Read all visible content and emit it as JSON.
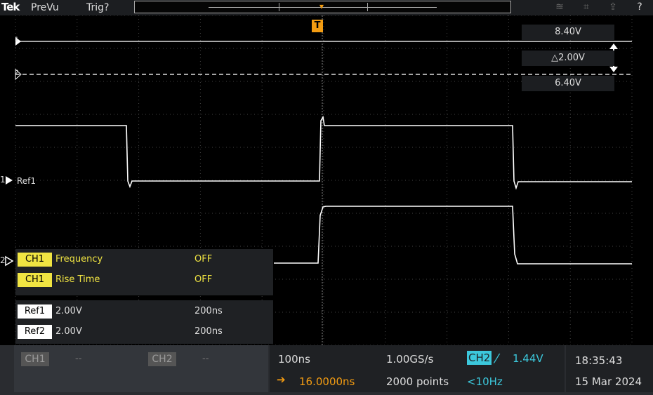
{
  "topbar": {
    "logo": "Tek",
    "mode": "PreVu",
    "trigger_status": "Trig?",
    "help": "?"
  },
  "cursor": {
    "upper": "8.40V",
    "delta": "△2.00V",
    "lower": "6.40V"
  },
  "trigger_marker": "T",
  "channels": {
    "ch1_marker": "1",
    "ch2_marker": "2",
    "ref1_label": "Ref1"
  },
  "measurements": [
    {
      "badge": "CH1",
      "name": "Frequency",
      "value": "OFF"
    },
    {
      "badge": "CH1",
      "name": "Rise Time",
      "value": "OFF"
    }
  ],
  "references": [
    {
      "badge": "Ref1",
      "scale": "2.00V",
      "time": "200ns"
    },
    {
      "badge": "Ref2",
      "scale": "2.00V",
      "time": "200ns"
    }
  ],
  "bottom": {
    "ch1": "CH1",
    "ch1_value": "--",
    "ch2": "CH2",
    "ch2_value": "--",
    "horizontal_scale": "100ns",
    "sample_rate": "1.00GS/s",
    "trigger_source": "CH2",
    "trigger_slope": "⁄",
    "trigger_level": "1.44V",
    "position_arrow": "➔",
    "position": "16.0000ns",
    "record_length": "2000 points",
    "trigger_freq": "<10Hz",
    "time": "18:35:43",
    "date": "15 Mar 2024"
  },
  "colors": {
    "accent": "#f39c12",
    "ch1": "#f0e442",
    "ch2": "#3cc8dc"
  }
}
